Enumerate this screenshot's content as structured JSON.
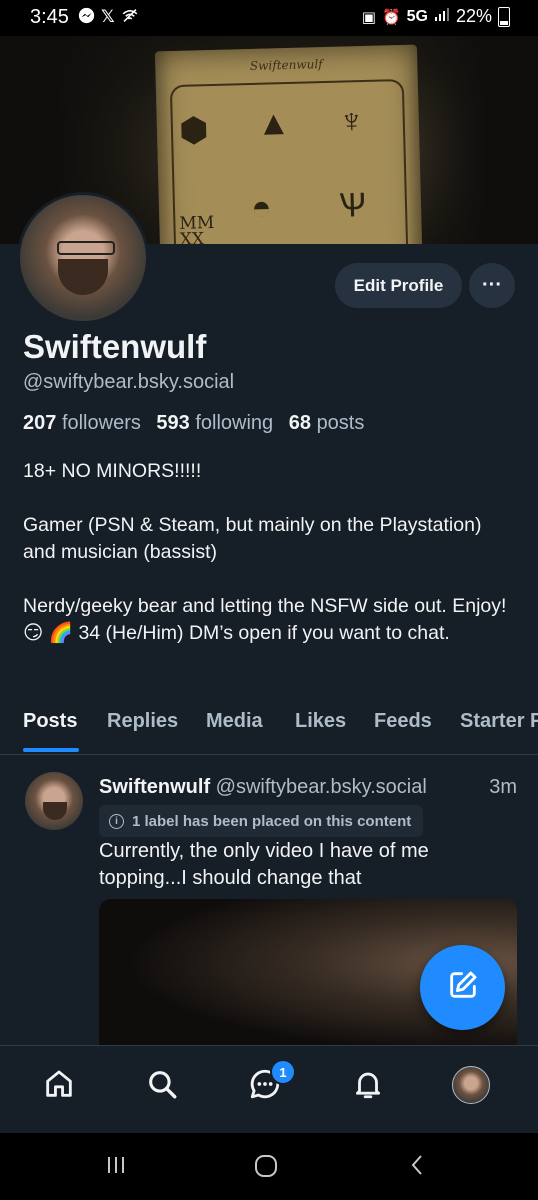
{
  "status_bar": {
    "time": "3:45",
    "network": "5G",
    "battery": "22%",
    "left_icons": [
      "messenger-icon",
      "x-icon",
      "wifi-off-icon"
    ]
  },
  "banner": {
    "card_text": "Swiftenwulf",
    "card_year": [
      "MM",
      "XX"
    ]
  },
  "profile": {
    "display_name": "Swiftenwulf",
    "handle": "@swiftybear.bsky.social",
    "followers_count": "207",
    "followers_label": "followers",
    "following_count": "593",
    "following_label": "following",
    "posts_count": "68",
    "posts_label": "posts",
    "edit_button": "Edit Profile",
    "more_button": "···",
    "bio": [
      "18+ NO MINORS!!!!!",
      "Gamer (PSN & Steam, but mainly on the Playstation) and musician (bassist)",
      "Nerdy/geeky bear and letting the NSFW side out. Enjoy! 😏 🌈 34 (He/Him) DM’s open if you want to chat."
    ]
  },
  "tabs": [
    "Posts",
    "Replies",
    "Media",
    "Likes",
    "Feeds",
    "Starter P"
  ],
  "active_tab": "Posts",
  "post": {
    "author_name": "Swiftenwulf",
    "author_handle": "@swiftybear.bsky.social",
    "time": "3m",
    "label_text": "1 label has been placed on this content",
    "text": "Currently, the only video I have of me topping...I should change that"
  },
  "bottom_nav": {
    "items": [
      "home-icon",
      "search-icon",
      "chat-icon",
      "notifications-icon",
      "profile-avatar"
    ],
    "chat_badge": "1"
  },
  "colors": {
    "background": "#161e27",
    "accent": "#208bfe",
    "secondary_text": "#aebbc9",
    "button_bg": "#26323f"
  }
}
